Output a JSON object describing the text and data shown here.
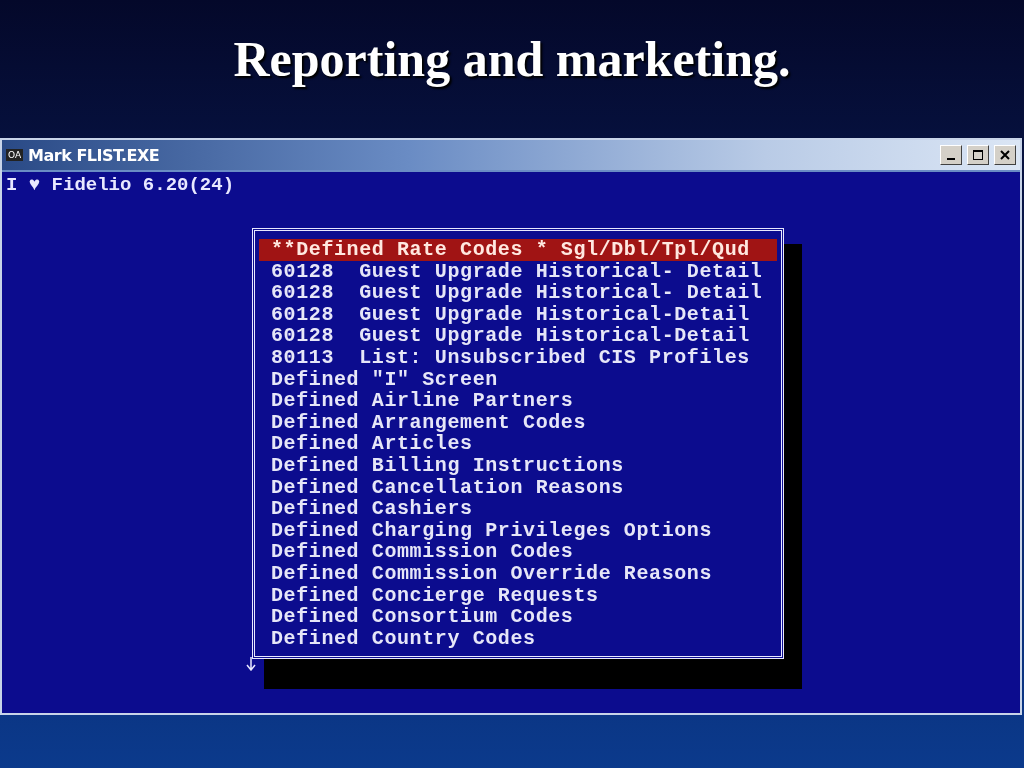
{
  "slide_title": "Reporting and marketing.",
  "window": {
    "title": "Mark FLIST.EXE",
    "icon_text": "OA"
  },
  "console_line": "I ♥ Fidelio 6.20(24)",
  "menu": {
    "items": [
      {
        "label": "**Defined Rate Codes * Sgl/Dbl/Tpl/Qud",
        "selected": true
      },
      {
        "label": "60128  Guest Upgrade Historical- Detail",
        "selected": false
      },
      {
        "label": "60128  Guest Upgrade Historical- Detail",
        "selected": false
      },
      {
        "label": "60128  Guest Upgrade Historical-Detail",
        "selected": false
      },
      {
        "label": "60128  Guest Upgrade Historical-Detail",
        "selected": false
      },
      {
        "label": "80113  List: Unsubscribed CIS Profiles",
        "selected": false
      },
      {
        "label": "Defined \"I\" Screen",
        "selected": false
      },
      {
        "label": "Defined Airline Partners",
        "selected": false
      },
      {
        "label": "Defined Arrangement Codes",
        "selected": false
      },
      {
        "label": "Defined Articles",
        "selected": false
      },
      {
        "label": "Defined Billing Instructions",
        "selected": false
      },
      {
        "label": "Defined Cancellation Reasons",
        "selected": false
      },
      {
        "label": "Defined Cashiers",
        "selected": false
      },
      {
        "label": "Defined Charging Privileges Options",
        "selected": false
      },
      {
        "label": "Defined Commission Codes",
        "selected": false
      },
      {
        "label": "Defined Commission Override Reasons",
        "selected": false
      },
      {
        "label": "Defined Concierge Requests",
        "selected": false
      },
      {
        "label": "Defined Consortium Codes",
        "selected": false
      },
      {
        "label": "Defined Country Codes",
        "selected": false
      }
    ]
  }
}
